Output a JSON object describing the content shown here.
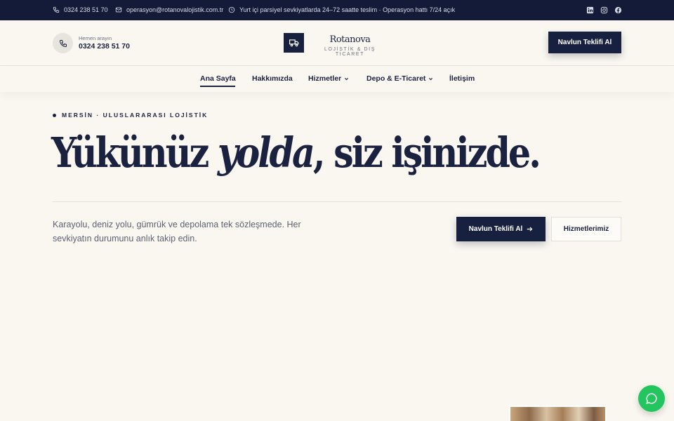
{
  "topbar": {
    "phone": "0324 238 51 70",
    "email": "operasyon@rotanovalojistik.com.tr",
    "notice": "Yurt içi parsiyel sevkiyatlarda 24–72 saatte teslim · Operasyon hattı 7/24 açık",
    "social_icons": [
      "linkedin-icon",
      "instagram-icon",
      "facebook-icon"
    ]
  },
  "header": {
    "call_label": "Hemen arayın",
    "call_number": "0324 238 51 70",
    "brand_name": "Rotanova",
    "brand_tagline": "LOJİSTİK & DIŞ TİCARET",
    "cta_label": "Navlun Teklifi Al"
  },
  "nav": {
    "items": [
      {
        "label": "Ana Sayfa",
        "active": true
      },
      {
        "label": "Hakkımızda"
      },
      {
        "label": "Hizmetler",
        "dropdown": true
      },
      {
        "label": "Depo & E-Ticaret",
        "dropdown": true
      },
      {
        "label": "İletişim"
      }
    ]
  },
  "hero": {
    "eyebrow": "MERSİN · ULUSLARARASI LOJİSTİK",
    "headline_part1": "Yükünüz ",
    "headline_emph": "yolda",
    "headline_part2": ", siz işinizde.",
    "lead": "Karayolu, deniz yolu, gümrük ve depolama tek sözleşmede. Her sevkiyatın durumunu anlık takip edin.",
    "primary_cta": "Navlun Teklifi Al",
    "secondary_cta": "Hizmetlerimiz"
  },
  "colors": {
    "navy": "#18203f",
    "background": "#faf7f1",
    "chat_green": "#22c55e"
  }
}
